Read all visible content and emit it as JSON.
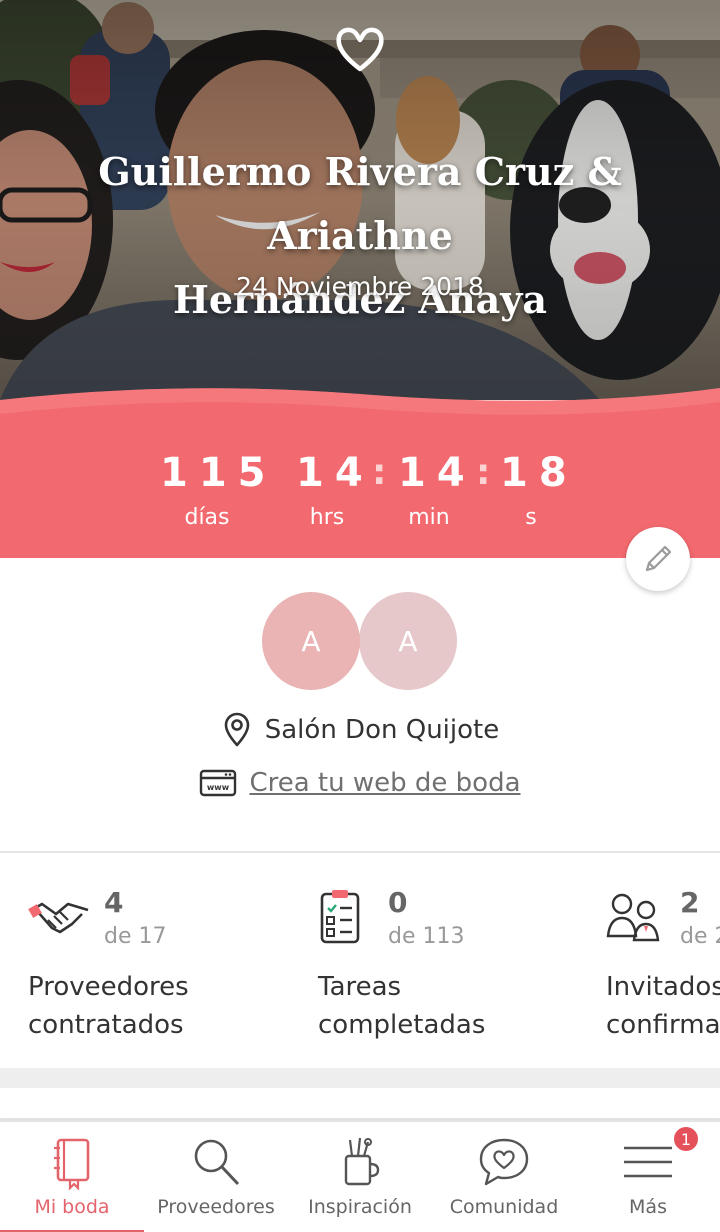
{
  "hero": {
    "couple_names_line1": "Guillermo Rivera Cruz & Ariathne",
    "couple_names_line2": "Hernández Anaya",
    "wedding_date": "24 Noviembre 2018"
  },
  "countdown": {
    "days": "115",
    "hours": "14",
    "minutes": "14",
    "seconds": "18",
    "separator": ":",
    "days_label": "días",
    "hours_label": "hrs",
    "minutes_label": "min",
    "seconds_label": "s"
  },
  "avatars": [
    {
      "initial": "A"
    },
    {
      "initial": "A"
    }
  ],
  "venue": {
    "name": "Salón Don Quijote",
    "icon": "location-pin-icon"
  },
  "website_link": {
    "label": "Crea tu web de boda",
    "icon": "web-browser-icon"
  },
  "stats": [
    {
      "count": "4",
      "total": "de 17",
      "label_line1": "Proveedores",
      "label_line2": "contratados",
      "icon": "handshake-icon"
    },
    {
      "count": "0",
      "total": "de 113",
      "label_line1": "Tareas",
      "label_line2": "completadas",
      "icon": "checklist-icon"
    },
    {
      "count": "2",
      "total": "de 2",
      "label_line1": "Invitados",
      "label_line2": "confirmados",
      "icon": "guests-icon"
    }
  ],
  "nav": {
    "items": [
      {
        "label": "Mi boda",
        "icon": "notebook-icon",
        "active": true
      },
      {
        "label": "Proveedores",
        "icon": "search-icon",
        "active": false
      },
      {
        "label": "Inspiración",
        "icon": "inspiration-cup-icon",
        "active": false
      },
      {
        "label": "Comunidad",
        "icon": "chat-heart-icon",
        "active": false
      },
      {
        "label": "Más",
        "icon": "menu-icon",
        "active": false
      }
    ],
    "more_badge": "1"
  },
  "colors": {
    "accent": "#e4646c",
    "band": "#f26a6f",
    "avatar_1": "#eab3b4",
    "avatar_2": "#e6c8ca"
  }
}
